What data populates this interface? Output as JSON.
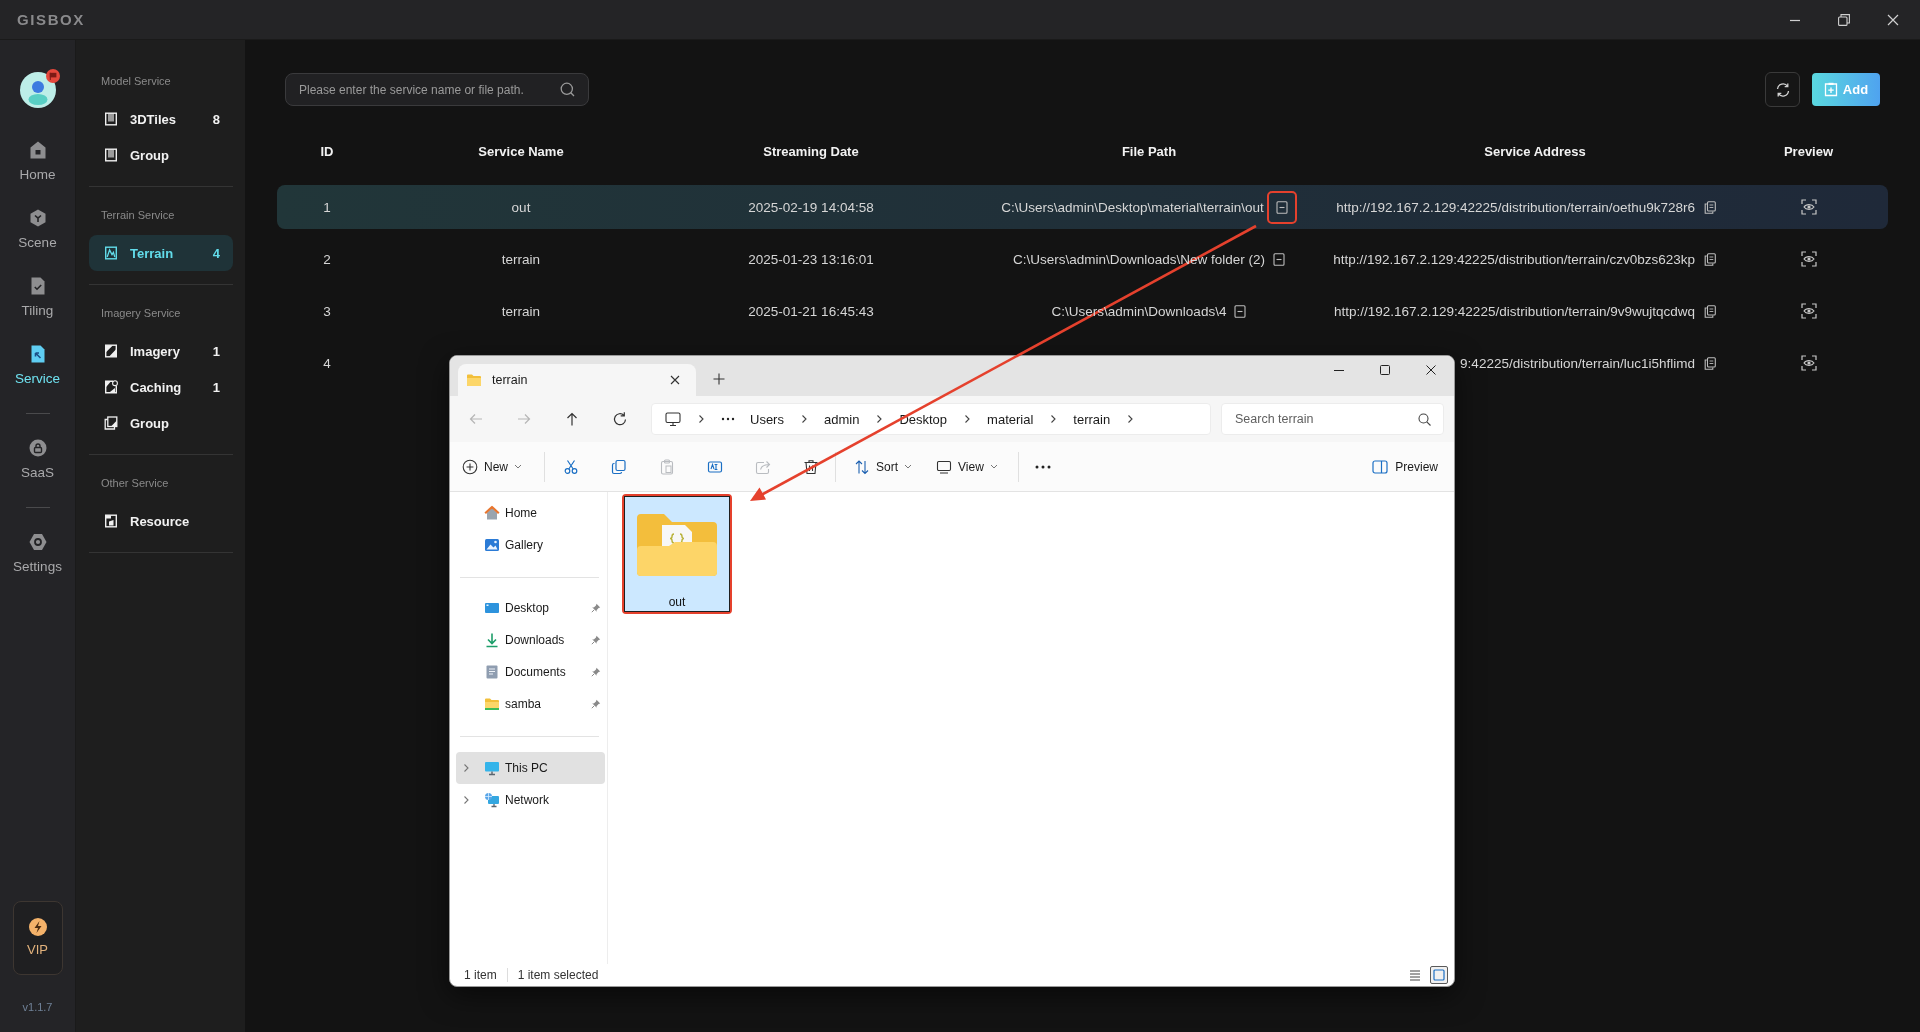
{
  "app": {
    "logo": "GISBOX"
  },
  "rail": {
    "avatar": {
      "notification": true
    },
    "groups": [
      [
        {
          "label": "Home",
          "kind": "home",
          "selected": false
        },
        {
          "label": "Scene",
          "kind": "scene",
          "selected": false
        },
        {
          "label": "Tiling",
          "kind": "tiling",
          "selected": false
        },
        {
          "label": "Service",
          "kind": "service",
          "selected": true
        }
      ],
      [
        {
          "label": "SaaS",
          "kind": "saas",
          "selected": false
        }
      ],
      [
        {
          "label": "Settings",
          "kind": "settings",
          "selected": false
        }
      ]
    ],
    "vip": {
      "label": "VIP"
    },
    "version": "v1.1.7"
  },
  "service_menu": {
    "sections": [
      {
        "title": "Model Service",
        "items": [
          {
            "label": "3DTiles",
            "kind": "model",
            "count": "8",
            "selected": false
          },
          {
            "label": "Group",
            "kind": "model",
            "selected": false
          }
        ]
      },
      {
        "title": "Terrain Service",
        "items": [
          {
            "label": "Terrain",
            "kind": "terrain",
            "count": "4",
            "selected": true
          }
        ]
      },
      {
        "title": "Imagery Service",
        "items": [
          {
            "label": "Imagery",
            "kind": "imagery",
            "count": "1",
            "selected": false
          },
          {
            "label": "Caching",
            "kind": "caching",
            "count": "1",
            "selected": false
          },
          {
            "label": "Group",
            "kind": "imagery-group",
            "selected": false
          }
        ]
      },
      {
        "title": "Other Service",
        "items": [
          {
            "label": "Resource",
            "kind": "resource",
            "selected": false
          }
        ]
      }
    ]
  },
  "toolbar": {
    "search": {
      "placeholder": "Please enter the service name or file path."
    },
    "add_button": "Add"
  },
  "table": {
    "columns": [
      "ID",
      "Service Name",
      "Streaming Date",
      "File Path",
      "Service Address",
      "Preview"
    ],
    "rows": [
      {
        "id": "1",
        "name": "out",
        "date": "2025-02-19 14:04:58",
        "path": "C:\\Users\\admin\\Desktop\\material\\terrain\\out",
        "address": "http://192.167.2.129:42225/distribution/terrain/oethu9k728r6",
        "selected": true,
        "highlighted": true
      },
      {
        "id": "2",
        "name": "terrain",
        "date": "2025-01-23 13:16:01",
        "path": "C:\\Users\\admin\\Downloads\\New folder (2)",
        "address": "http://192.167.2.129:42225/distribution/terrain/czv0bzs623kp",
        "selected": false,
        "highlighted": false
      },
      {
        "id": "3",
        "name": "terrain",
        "date": "2025-01-21 16:45:43",
        "path": "C:\\Users\\admin\\Downloads\\4",
        "address": "http://192.167.2.129:42225/distribution/terrain/9v9wujtqcdwq",
        "selected": false,
        "highlighted": false
      },
      {
        "id": "4",
        "address": "9:42225/distribution/terrain/luc1i5hflimd",
        "selected": false
      }
    ]
  },
  "explorer": {
    "tabs": [
      {
        "title": "terrain",
        "selected": true
      }
    ],
    "nav_buttons": [
      {
        "kind": "back",
        "disabled": true
      },
      {
        "kind": "forward",
        "disabled": true
      },
      {
        "kind": "up",
        "disabled": false
      },
      {
        "kind": "refresh",
        "disabled": false
      }
    ],
    "breadcrumb": [
      "Users",
      "admin",
      "Desktop",
      "material",
      "terrain"
    ],
    "search": {
      "placeholder": "Search terrain"
    },
    "commands": [
      {
        "kind": "new",
        "label": "New"
      },
      {
        "kind": "cut",
        "disabled": false
      },
      {
        "kind": "copy",
        "disabled": false
      },
      {
        "kind": "paste",
        "disabled": true
      },
      {
        "kind": "rename",
        "disabled": false
      },
      {
        "kind": "share",
        "disabled": true
      },
      {
        "kind": "delete",
        "disabled": false
      },
      {
        "kind": "sort",
        "label": "Sort"
      },
      {
        "kind": "view",
        "label": "View"
      },
      {
        "kind": "more"
      }
    ],
    "preview_button": "Preview",
    "nav_groups": [
      [
        {
          "label": "Home",
          "kind": "home",
          "selected": false
        },
        {
          "label": "Gallery",
          "kind": "gallery",
          "selected": false
        }
      ],
      [
        {
          "label": "Desktop",
          "kind": "desktop",
          "pinned": true,
          "selected": false
        },
        {
          "label": "Downloads",
          "kind": "downloads",
          "pinned": true,
          "selected": false
        },
        {
          "label": "Documents",
          "kind": "documents",
          "pinned": true,
          "selected": false
        },
        {
          "label": "samba",
          "kind": "folder",
          "pinned": true,
          "selected": false
        }
      ],
      [
        {
          "label": "This PC",
          "kind": "pc",
          "expanded": false,
          "selected": true
        },
        {
          "label": "Network",
          "kind": "network",
          "expanded": false,
          "selected": false
        }
      ]
    ],
    "items": [
      {
        "name": "out",
        "kind": "folder",
        "selected": true,
        "highlighted": true
      }
    ],
    "status": [
      "1 item",
      "1 item selected"
    ],
    "view_modes": [
      {
        "kind": "details",
        "selected": false
      },
      {
        "kind": "large-icons",
        "selected": true
      }
    ]
  }
}
